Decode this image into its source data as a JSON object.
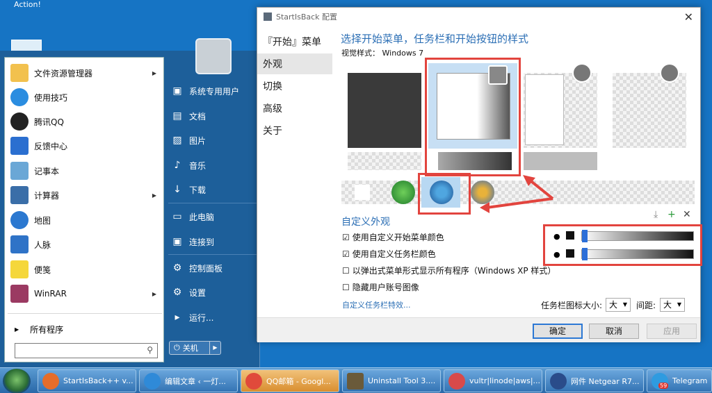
{
  "desktop": {
    "label": "Action!"
  },
  "start_menu": {
    "left_items": [
      {
        "label": "文件资源管理器",
        "arrow": "▶",
        "color": "#f2c14e"
      },
      {
        "label": "使用技巧",
        "arrow": "",
        "color": "#2b8de0"
      },
      {
        "label": "腾讯QQ",
        "arrow": "",
        "color": "#222"
      },
      {
        "label": "反馈中心",
        "arrow": "",
        "color": "#2b6fd0"
      },
      {
        "label": "记事本",
        "arrow": "",
        "color": "#6aa7d6"
      },
      {
        "label": "计算器",
        "arrow": "▶",
        "color": "#3a6ea8"
      },
      {
        "label": "地图",
        "arrow": "",
        "color": "#2b78d0"
      },
      {
        "label": "人脉",
        "arrow": "",
        "color": "#2f73c7"
      },
      {
        "label": "便笺",
        "arrow": "",
        "color": "#f5d73b"
      },
      {
        "label": "WinRAR",
        "arrow": "▶",
        "color": "#9b3a62"
      }
    ],
    "all_programs": "所有程序",
    "search_placeholder": "",
    "right_items": [
      {
        "label": "系统专用用户",
        "icon": "▣"
      },
      {
        "label": "文档",
        "icon": "▤"
      },
      {
        "label": "图片",
        "icon": "▨"
      },
      {
        "label": "音乐",
        "icon": "♪"
      },
      {
        "label": "下载",
        "icon": "↓"
      },
      {
        "label": "此电脑",
        "icon": "▭"
      },
      {
        "label": "连接到",
        "icon": "▣"
      },
      {
        "label": "控制面板",
        "icon": "⚙"
      },
      {
        "label": "设置",
        "icon": "⚙"
      },
      {
        "label": "运行...",
        "icon": "▸"
      }
    ],
    "shutdown": "关机",
    "power_icon": "⏻",
    "split_arrow": "▶"
  },
  "dialog": {
    "title": "StartIsBack 配置",
    "close": "✕",
    "nav": [
      "『开始』菜单",
      "外观",
      "切换",
      "高级",
      "关于"
    ],
    "heading": "选择开始菜单，任务栏和开始按钮的样式",
    "visual_style_label": "视觉样式：",
    "visual_style_value": "Windows 7",
    "custom_heading": "自定义外观",
    "options": [
      {
        "label": "使用自定义开始菜单颜色",
        "checked": "☑"
      },
      {
        "label": "使用自定义任务栏颜色",
        "checked": "☑"
      },
      {
        "label": "以弹出式菜单形式显示所有程序（Windows XP 样式）",
        "checked": "☐"
      },
      {
        "label": "隐藏用户账号图像",
        "checked": "☐"
      }
    ],
    "tools": {
      "download": "⤓",
      "add": "+",
      "remove": "✕"
    },
    "link": "自定义任务栏特效...",
    "icon_size_label": "任务栏图标大小:",
    "icon_size_value": "大",
    "spacing_label": "间距:",
    "spacing_value": "大",
    "buttons": {
      "ok": "确定",
      "cancel": "取消",
      "apply": "应用"
    }
  },
  "taskbar": {
    "items": [
      {
        "label": "StartIsBack++ v...",
        "color": "#e66d2a"
      },
      {
        "label": "编辑文章 ‹ 一灯...",
        "color": "#2f8ad8"
      },
      {
        "label": "QQ邮箱 - Googl...",
        "color": "#e04a3b"
      },
      {
        "label": "Uninstall Tool 3....",
        "color": "#6a5a3a"
      },
      {
        "label": "vultr|linode|aws|...",
        "color": "#d84a4a"
      },
      {
        "label": "网件 Netgear R7...",
        "color": "#2a4c8a"
      },
      {
        "label": "Telegram",
        "color": "#2f9be0"
      }
    ],
    "badge": "59"
  }
}
